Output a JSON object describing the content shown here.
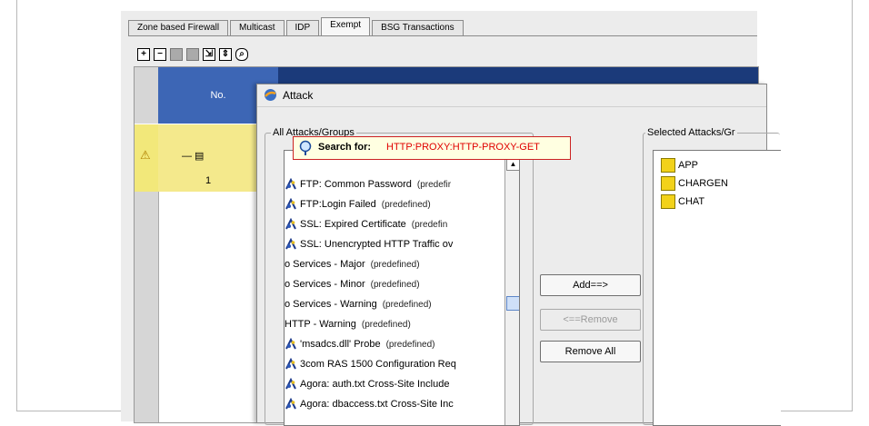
{
  "tabs": [
    "Zone based Firewall",
    "Multicast",
    "IDP",
    "Exempt",
    "BSG Transactions"
  ],
  "active_tab": "Exempt",
  "toolbar": {
    "icons": [
      "plus-icon",
      "minus-icon",
      "move-up-icon",
      "move-down-icon",
      "collapse-icon",
      "expand-icon",
      "search-icon"
    ]
  },
  "grid": {
    "col_no": "No.",
    "row": {
      "number": "1",
      "warning": "⚠"
    }
  },
  "dialog": {
    "title": "Attack",
    "all_group_label": "All Attacks/Groups",
    "selected_group_label": "Selected Attacks/Gr",
    "search": {
      "label": "Search for:",
      "value": "HTTP:PROXY:HTTP-PROXY-GET"
    },
    "attack_list": [
      {
        "name": "FTP: Common Password",
        "tag": "(predefir"
      },
      {
        "name": "FTP:Login Failed",
        "tag": "(predefined)"
      },
      {
        "name": "SSL: Expired Certificate",
        "tag": "(predefin"
      },
      {
        "name": "SSL: Unencrypted HTTP Traffic ov",
        "tag": ""
      },
      {
        "name": "o Services - Major",
        "tag": "(predefined)"
      },
      {
        "name": "o Services - Minor",
        "tag": "(predefined)"
      },
      {
        "name": "o Services - Warning",
        "tag": "(predefined)"
      },
      {
        "name": "HTTP - Warning",
        "tag": "(predefined)"
      },
      {
        "name": "'msadcs.dll' Probe",
        "tag": "(predefined)"
      },
      {
        "name": "3com RAS 1500 Configuration Req",
        "tag": ""
      },
      {
        "name": "Agora: auth.txt Cross-Site Include",
        "tag": ""
      },
      {
        "name": "Agora: dbaccess.txt Cross-Site Inc",
        "tag": ""
      }
    ],
    "buttons": {
      "add": "Add==>",
      "remove": "<==Remove",
      "remove_all": "Remove All"
    },
    "selected": [
      "APP",
      "CHARGEN",
      "CHAT"
    ]
  }
}
